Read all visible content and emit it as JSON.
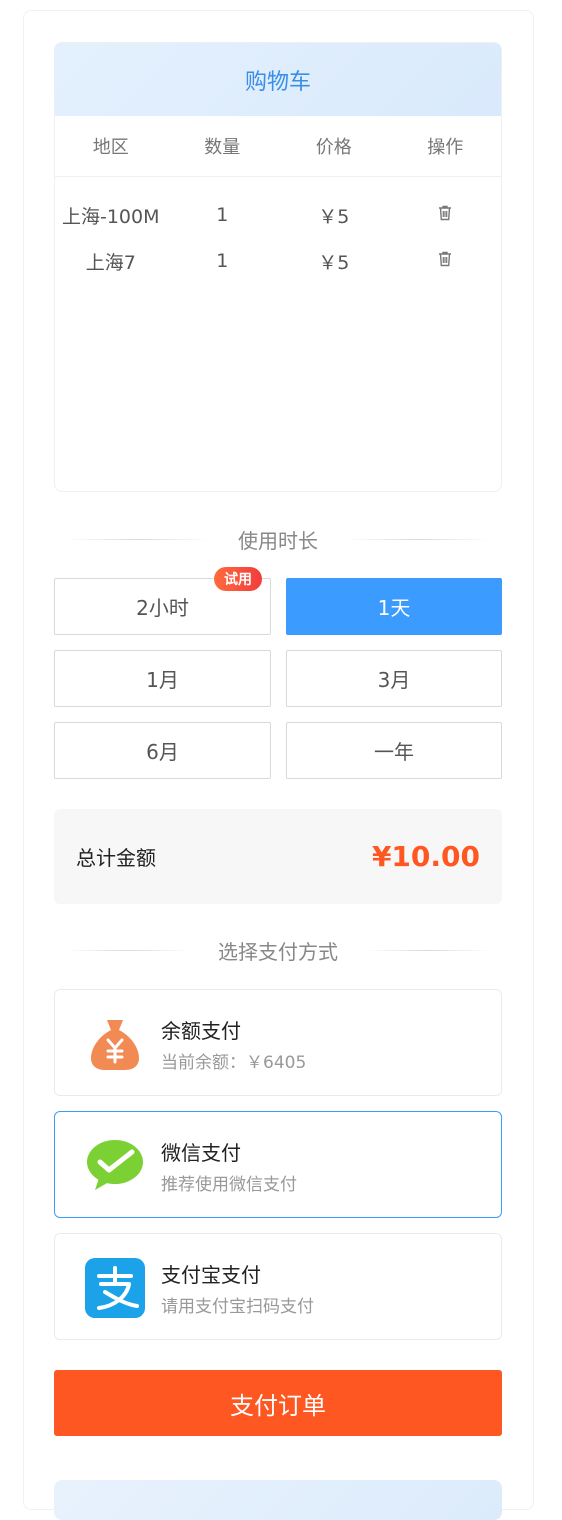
{
  "cart": {
    "title": "购物车",
    "columns": [
      "地区",
      "数量",
      "价格",
      "操作"
    ],
    "rows": [
      {
        "region": "上海-100M",
        "qty": "1",
        "price": "￥5"
      },
      {
        "region": "上海7",
        "qty": "1",
        "price": "￥5"
      }
    ]
  },
  "duration": {
    "title": "使用时长",
    "trial_badge": "试用",
    "options": [
      "2小时",
      "1天",
      "1月",
      "3月",
      "6月",
      "一年"
    ],
    "selected": "1天"
  },
  "total": {
    "label": "总计金额",
    "amount": "¥10.00"
  },
  "payment": {
    "title": "选择支付方式",
    "methods": [
      {
        "name": "余额支付",
        "desc": "当前余额：￥6405",
        "icon": "money-bag-icon"
      },
      {
        "name": "微信支付",
        "desc": "推荐使用微信支付",
        "icon": "wechat-pay-icon"
      },
      {
        "name": "支付宝支付",
        "desc": "请用支付宝扫码支付",
        "icon": "alipay-icon"
      }
    ],
    "selected": "微信支付"
  },
  "submit_label": "支付订单",
  "colors": {
    "accent": "#3b9bff",
    "primary": "#ff5722",
    "wechat": "#7bd134",
    "alipay": "#1ba2e9",
    "balance": "#f28a54"
  }
}
